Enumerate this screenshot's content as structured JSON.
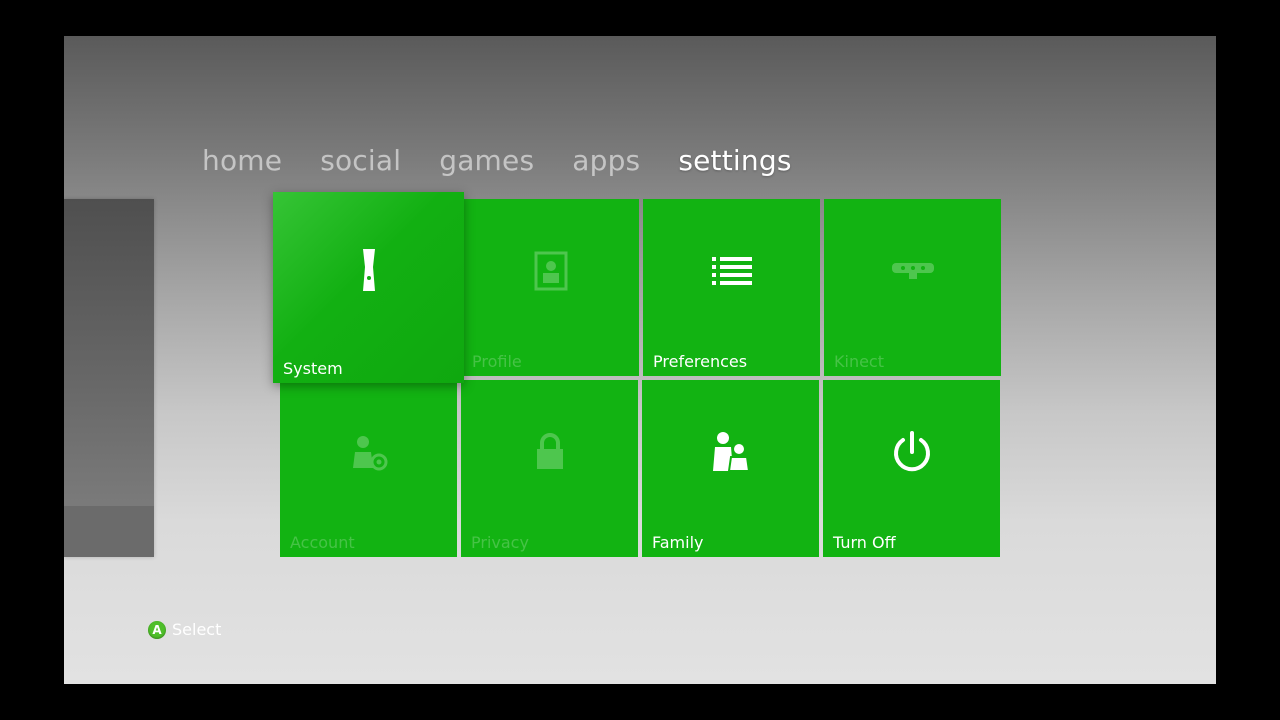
{
  "nav": {
    "items": [
      {
        "label": "home"
      },
      {
        "label": "social"
      },
      {
        "label": "games"
      },
      {
        "label": "apps"
      },
      {
        "label": "settings"
      }
    ],
    "active": "settings"
  },
  "tiles": [
    {
      "label": "System",
      "icon": "system-exclamation-icon",
      "state": "focused"
    },
    {
      "label": "Profile",
      "icon": "profile-icon",
      "state": "dim"
    },
    {
      "label": "Preferences",
      "icon": "list-icon",
      "state": "normal"
    },
    {
      "label": "Kinect",
      "icon": "kinect-sensor-icon",
      "state": "dim"
    },
    {
      "label": "Account",
      "icon": "account-gear-icon",
      "state": "dim"
    },
    {
      "label": "Privacy",
      "icon": "lock-icon",
      "state": "dim"
    },
    {
      "label": "Family",
      "icon": "family-icon",
      "state": "normal"
    },
    {
      "label": "Turn Off",
      "icon": "power-icon",
      "state": "normal"
    }
  ],
  "footer": {
    "button_glyph": "A",
    "action_label": "Select"
  },
  "colors": {
    "tile_green": "#12b312",
    "a_button_green": "#4fbf2a"
  }
}
